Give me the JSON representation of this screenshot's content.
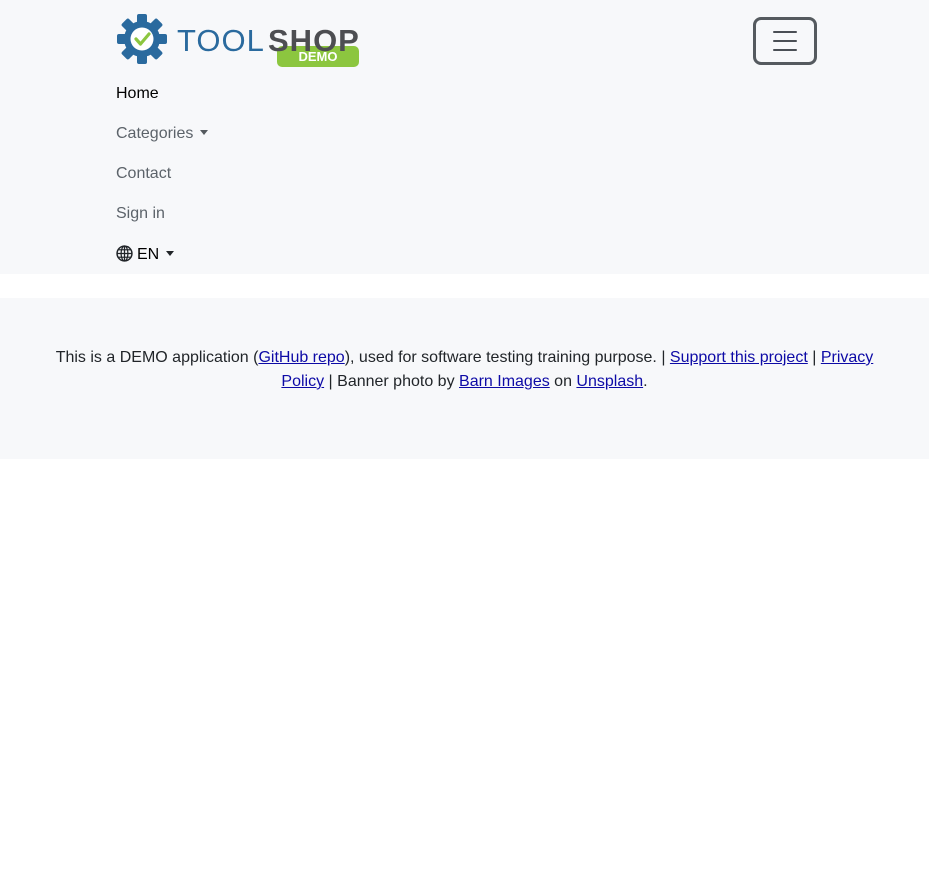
{
  "header": {
    "logo": {
      "brand_left": "TOOL",
      "brand_right": "SHOP",
      "badge": "DEMO",
      "colors": {
        "blue": "#2a6a9e",
        "gray": "#4d4e52",
        "green": "#8cc63f"
      }
    },
    "menu_toggle_icon": "hamburger-icon",
    "nav": {
      "home": "Home",
      "categories": "Categories",
      "contact": "Contact",
      "sign_in": "Sign in",
      "language": "EN",
      "language_icon": "globe-icon"
    }
  },
  "footer": {
    "text_1": "This is a DEMO application (",
    "link_github": "GitHub repo",
    "text_2": "), used for software testing training purpose. | ",
    "link_support": "Support this project",
    "text_3": " | ",
    "link_privacy": "Privacy Policy",
    "text_4": " | Banner photo by ",
    "link_barn": "Barn Images",
    "text_5": " on ",
    "link_unsplash": "Unsplash",
    "text_6": ".",
    "link_color": "#0d0aa6"
  }
}
